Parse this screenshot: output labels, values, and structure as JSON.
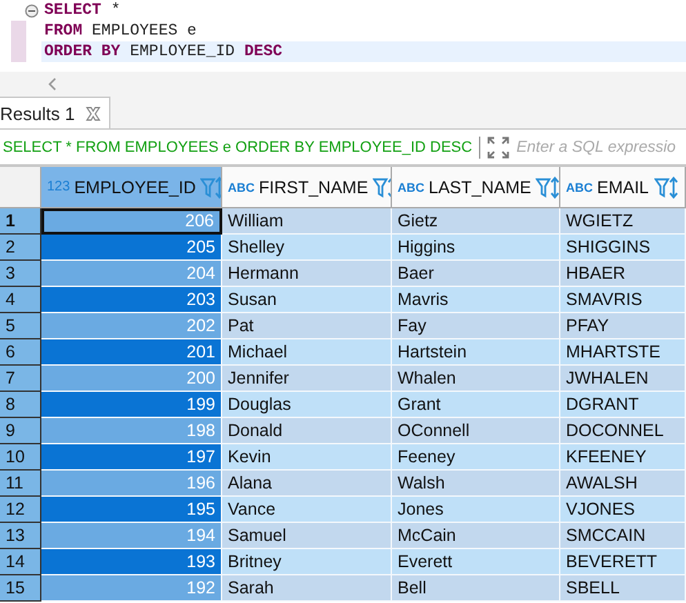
{
  "editor": {
    "lines": [
      {
        "tokens": [
          {
            "text": "SELECT",
            "kind": "keyword"
          },
          {
            "text": " *",
            "kind": "plain"
          }
        ],
        "current": false,
        "foldable": true
      },
      {
        "tokens": [
          {
            "text": "FROM",
            "kind": "keyword"
          },
          {
            "text": " EMPLOYEES e",
            "kind": "plain"
          }
        ],
        "current": false,
        "foldable": false
      },
      {
        "tokens": [
          {
            "text": "ORDER BY",
            "kind": "keyword"
          },
          {
            "text": " EMPLOYEE_ID ",
            "kind": "plain"
          },
          {
            "text": "DESC",
            "kind": "keyword"
          }
        ],
        "current": true,
        "foldable": false
      }
    ]
  },
  "results_tab": {
    "label": "Results 1",
    "selected": true
  },
  "filter_bar": {
    "query": "SELECT * FROM EMPLOYEES e ORDER BY EMPLOYEE_ID DESC",
    "placeholder": "Enter a SQL expressio"
  },
  "table": {
    "columns": [
      {
        "type_label": "123",
        "name": "EMPLOYEE_ID",
        "kind": "number",
        "selected": true
      },
      {
        "type_label": "ABC",
        "name": "FIRST_NAME",
        "kind": "text",
        "selected": false
      },
      {
        "type_label": "ABC",
        "name": "LAST_NAME",
        "kind": "text",
        "selected": false
      },
      {
        "type_label": "ABC",
        "name": "EMAIL",
        "kind": "text",
        "selected": false
      }
    ],
    "rows": [
      {
        "number": "1",
        "current": true,
        "cells": [
          "206",
          "William",
          "Gietz",
          "WGIETZ"
        ]
      },
      {
        "number": "2",
        "current": false,
        "cells": [
          "205",
          "Shelley",
          "Higgins",
          "SHIGGINS"
        ]
      },
      {
        "number": "3",
        "current": false,
        "cells": [
          "204",
          "Hermann",
          "Baer",
          "HBAER"
        ]
      },
      {
        "number": "4",
        "current": false,
        "cells": [
          "203",
          "Susan",
          "Mavris",
          "SMAVRIS"
        ]
      },
      {
        "number": "5",
        "current": false,
        "cells": [
          "202",
          "Pat",
          "Fay",
          "PFAY"
        ]
      },
      {
        "number": "6",
        "current": false,
        "cells": [
          "201",
          "Michael",
          "Hartstein",
          "MHARTSTE"
        ]
      },
      {
        "number": "7",
        "current": false,
        "cells": [
          "200",
          "Jennifer",
          "Whalen",
          "JWHALEN"
        ]
      },
      {
        "number": "8",
        "current": false,
        "cells": [
          "199",
          "Douglas",
          "Grant",
          "DGRANT"
        ]
      },
      {
        "number": "9",
        "current": false,
        "cells": [
          "198",
          "Donald",
          "OConnell",
          "DOCONNEL"
        ]
      },
      {
        "number": "10",
        "current": false,
        "cells": [
          "197",
          "Kevin",
          "Feeney",
          "KFEENEY"
        ]
      },
      {
        "number": "11",
        "current": false,
        "cells": [
          "196",
          "Alana",
          "Walsh",
          "AWALSH"
        ]
      },
      {
        "number": "12",
        "current": false,
        "cells": [
          "195",
          "Vance",
          "Jones",
          "VJONES"
        ]
      },
      {
        "number": "13",
        "current": false,
        "cells": [
          "194",
          "Samuel",
          "McCain",
          "SMCCAIN"
        ]
      },
      {
        "number": "14",
        "current": false,
        "cells": [
          "193",
          "Britney",
          "Everett",
          "BEVERETT"
        ]
      },
      {
        "number": "15",
        "current": false,
        "cells": [
          "192",
          "Sarah",
          "Bell",
          "SBELL"
        ]
      }
    ]
  }
}
